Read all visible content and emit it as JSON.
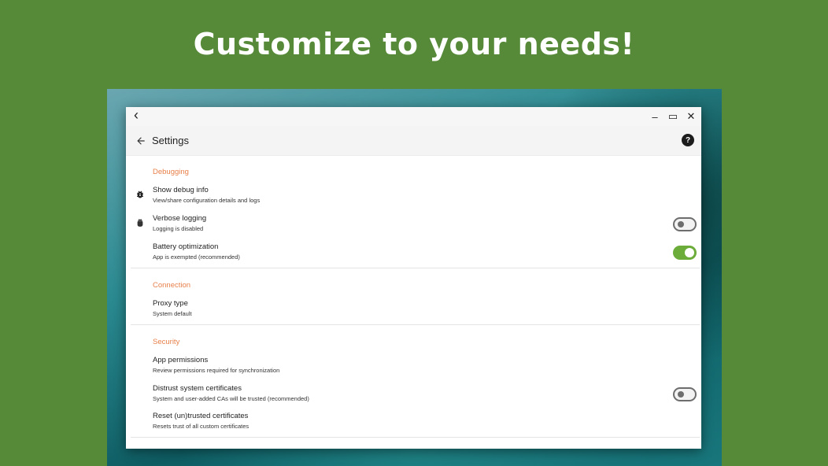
{
  "headline": "Customize to your needs!",
  "window": {
    "back_glyph": "‹",
    "minimize_glyph": "–",
    "maximize_glyph": "▭",
    "close_glyph": "✕"
  },
  "appbar": {
    "title": "Settings",
    "help_glyph": "?",
    "icons": {
      "back": "arrow-back-icon",
      "help": "help-icon"
    }
  },
  "sections": {
    "debugging": {
      "title": "Debugging",
      "items": [
        {
          "title": "Show debug info",
          "summary": "View/share configuration details and logs",
          "icon": "bug-icon"
        },
        {
          "title": "Verbose logging",
          "summary": "Logging is disabled",
          "icon": "android-bug-icon",
          "switch": false
        },
        {
          "title": "Battery optimization",
          "summary": "App is exempted (recommended)",
          "switch": true
        }
      ]
    },
    "connection": {
      "title": "Connection",
      "items": [
        {
          "title": "Proxy type",
          "summary": "System default"
        }
      ]
    },
    "security": {
      "title": "Security",
      "items": [
        {
          "title": "App permissions",
          "summary": "Review permissions required for synchronization"
        },
        {
          "title": "Distrust system certificates",
          "summary": "System and user-added CAs will be trusted (recommended)",
          "switch": false
        },
        {
          "title": "Reset (un)trusted certificates",
          "summary": "Resets trust of all custom certificates"
        }
      ]
    }
  },
  "colors": {
    "background": "#568a38",
    "accent_orange": "#e8804a",
    "switch_on": "#6cac3a",
    "switch_off": "#6d6d6d"
  }
}
